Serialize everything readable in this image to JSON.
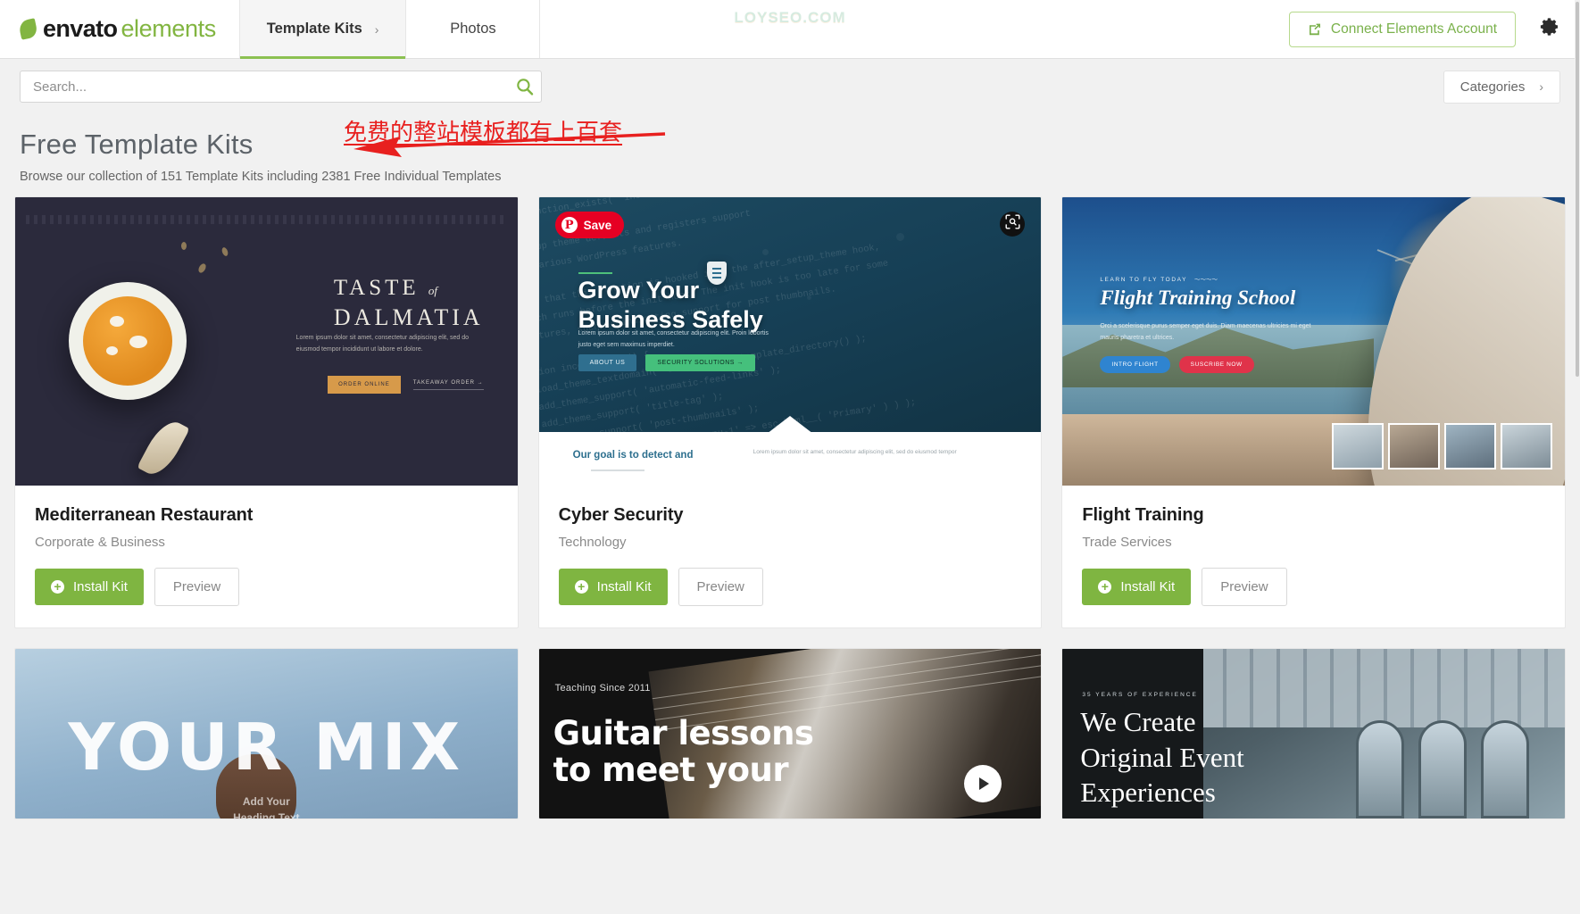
{
  "header": {
    "brand_primary": "envato",
    "brand_secondary": "elements",
    "brand_leaf_icon": "leaf-icon",
    "watermark": "LOYSEO.COM",
    "tabs": [
      {
        "label": "Template Kits",
        "chevron": "›",
        "active": true
      },
      {
        "label": "Photos",
        "chevron": "",
        "active": false
      }
    ],
    "connect_button": {
      "label": "Connect Elements Account",
      "icon": "external-link-icon",
      "color": "#7ab14b"
    },
    "settings_icon": "gear-icon"
  },
  "search": {
    "placeholder": "Search...",
    "value": "",
    "icon": "search-icon",
    "icon_color": "#7fb541"
  },
  "categories_button": {
    "label": "Categories",
    "chevron": "›"
  },
  "page": {
    "title": "Free Template Kits",
    "subtitle": "Browse our collection of 151 Template Kits including 2381 Free Individual Templates",
    "kit_count": "151",
    "template_count": "2381"
  },
  "annotation": {
    "text": "免费的整站模板都有上百套",
    "color": "#e8201f",
    "arrow": "left-arrow-annotation"
  },
  "buttons": {
    "install_label": "Install Kit",
    "preview_label": "Preview",
    "install_icon": "plus-circle-icon",
    "install_color": "#7fb541"
  },
  "overlays": {
    "pinterest_save": "Save",
    "pinterest_icon": "pinterest-icon",
    "pinterest_color": "#e60023",
    "focus_icon": "focus-search-icon",
    "play_icon": "play-icon"
  },
  "cards": [
    {
      "title": "Mediterranean Restaurant",
      "category": "Corporate & Business",
      "thumb": {
        "headline_line1": "TASTE",
        "headline_of": "of",
        "headline_line2": "DALMATIA",
        "paragraph": "Lorem ipsum dolor sit amet, consectetur adipiscing elit, sed do eiusmod tempor incididunt ut labore et dolore.",
        "button1": "ORDER ONLINE",
        "button2": "TAKEAWAY ORDER →"
      }
    },
    {
      "title": "Cyber Security",
      "category": "Technology",
      "has_pinterest_save": true,
      "has_focus_button": true,
      "thumb": {
        "headline_line1": "Grow Your",
        "headline_line2": "Business Safely",
        "paragraph": "Lorem ipsum dolor sit amet, consectetur adipiscing elit. Proin lobortis justo eget sem maximus imperdiet.",
        "button1": "ABOUT US",
        "button2": "SECURITY SOLUTIONS →",
        "strip_headline": "Our goal is to detect and",
        "strip_paragraph": "Lorem ipsum dolor sit amet, consectetur adipiscing elit, sed do eiusmod tempor"
      }
    },
    {
      "title": "Flight Training",
      "category": "Trade Services",
      "thumb": {
        "eyebrow": "LEARN TO FLY TODAY",
        "headline": "Flight Training School",
        "paragraph": "Orci a scelerisque purus semper eget duis. Diam maecenas ultricies mi eget mauris pharetra et ultrices.",
        "button1": "INTRO FLIGHT",
        "button2": "SUSCRIBE NOW"
      }
    }
  ],
  "cards_row2": [
    {
      "thumb": {
        "headline": "YOUR MIX",
        "subline_1": "Add Your",
        "subline_2": "Heading Text"
      }
    },
    {
      "has_play_button": true,
      "thumb": {
        "eyebrow": "Teaching Since 2011",
        "headline_line1": "Guitar lessons",
        "headline_line2": "to meet your"
      }
    },
    {
      "thumb": {
        "eyebrow": "35 YEARS OF EXPERIENCE",
        "headline_line1": "We Create",
        "headline_line2": "Original Event",
        "headline_line3": "Experiences"
      }
    }
  ]
}
